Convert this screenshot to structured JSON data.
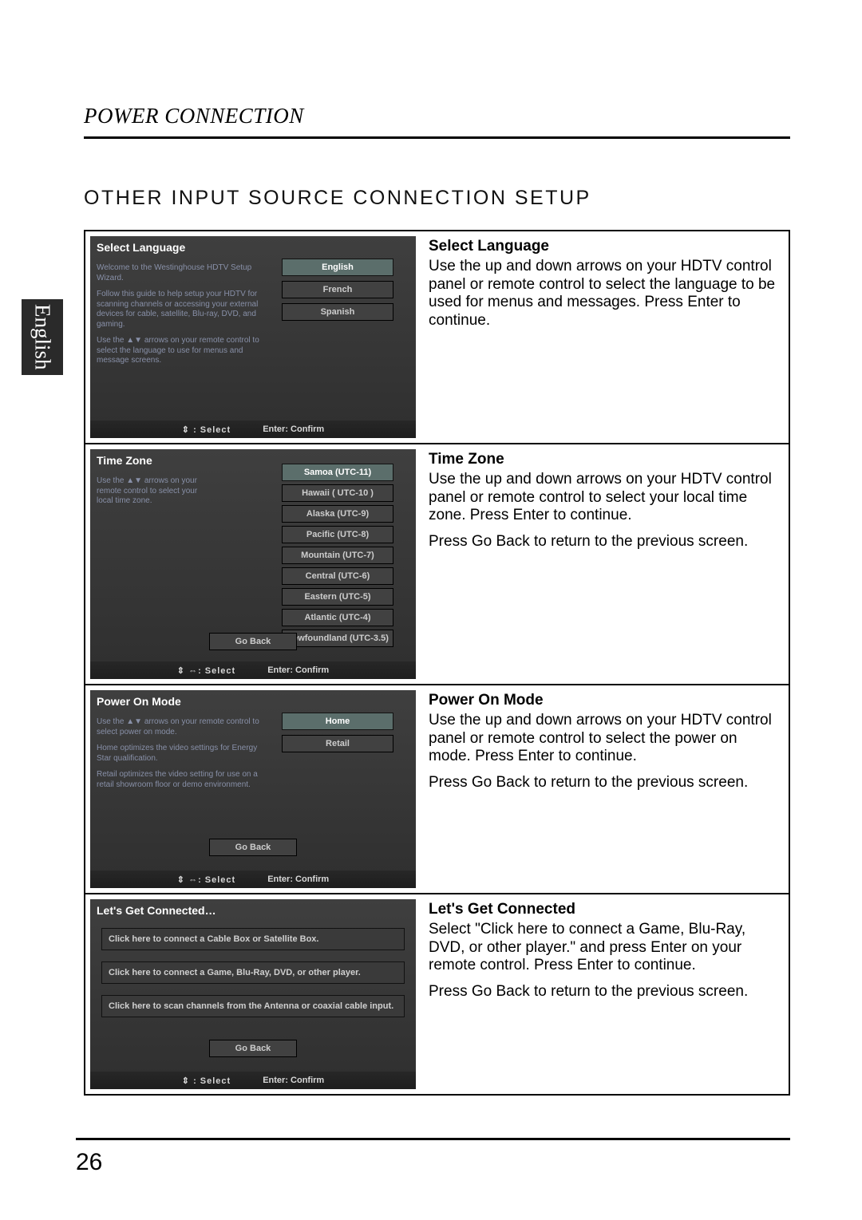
{
  "side_tab": "English",
  "header": "POWER CONNECTION",
  "section_title": "OTHER INPUT SOURCE CONNECTION SETUP",
  "page_number": "26",
  "footer": {
    "select_ud": "⇕ : Select",
    "select_udlr": "⇕ ⇔: Select",
    "confirm": "Enter: Confirm"
  },
  "panels": [
    {
      "screen_title": "Select Language",
      "screen_paras": [
        "Welcome to the Westinghouse HDTV Setup Wizard.",
        "Follow this guide to help setup your HDTV for scanning channels or accessing your external devices for cable, satellite, Blu-ray, DVD, and gaming.",
        "Use the ▲▼ arrows on your remote control to select the language to use for menus and message screens."
      ],
      "options": [
        "English",
        "French",
        "Spanish"
      ],
      "selected": 0,
      "goback": false,
      "footer_mode": "ud",
      "desc_title": "Select Language",
      "desc_paras": [
        "Use the up and down arrows on your HDTV control panel or remote control to select the language to be used for menus and messages. Press Enter to continue."
      ]
    },
    {
      "screen_title": "Time Zone",
      "screen_paras": [
        "Use the ▲▼ arrows on your remote control to select your local time zone."
      ],
      "options": [
        "Samoa (UTC-11)",
        "Hawaii ( UTC-10 )",
        "Alaska (UTC-9)",
        "Pacific (UTC-8)",
        "Mountain (UTC-7)",
        "Central (UTC-6)",
        "Eastern (UTC-5)",
        "Atlantic (UTC-4)",
        "Newfoundland (UTC-3.5)"
      ],
      "selected": 0,
      "goback": true,
      "goback_label": "Go Back",
      "footer_mode": "udlr",
      "desc_title": "Time Zone",
      "desc_paras": [
        "Use the up and down arrows on your HDTV control panel or remote control to select your local time zone. Press Enter to continue.",
        "Press Go Back to return to the previous screen."
      ]
    },
    {
      "screen_title": "Power On Mode",
      "screen_paras": [
        "Use the ▲▼ arrows on your remote control to select power on mode.",
        "Home optimizes the video settings for Energy Star qualification.",
        "Retail optimizes the video setting for use on a retail showroom floor or demo environment."
      ],
      "options": [
        "Home",
        "Retail"
      ],
      "selected": 0,
      "goback": true,
      "goback_label": "Go Back",
      "footer_mode": "udlr",
      "desc_title": "Power On Mode",
      "desc_paras": [
        "Use the up and down arrows on your HDTV control panel or remote control to select the power on mode. Press Enter to continue.",
        "Press Go Back to return to the previous screen."
      ]
    },
    {
      "screen_title": "Let's Get Connected…",
      "connect_items": [
        "Click here to connect a Cable Box or Satellite Box.",
        "Click here to connect a Game, Blu-Ray, DVD, or other player.",
        "Click here to scan channels from the Antenna or coaxial cable input."
      ],
      "goback": true,
      "goback_label": "Go Back",
      "footer_mode": "ud",
      "desc_title": "Let's Get Connected",
      "desc_paras": [
        "Select \"Click here to connect a Game, Blu-Ray, DVD, or other player.\" and press Enter on your remote control. Press Enter to continue.",
        "Press Go Back to return to the previous screen."
      ]
    }
  ]
}
